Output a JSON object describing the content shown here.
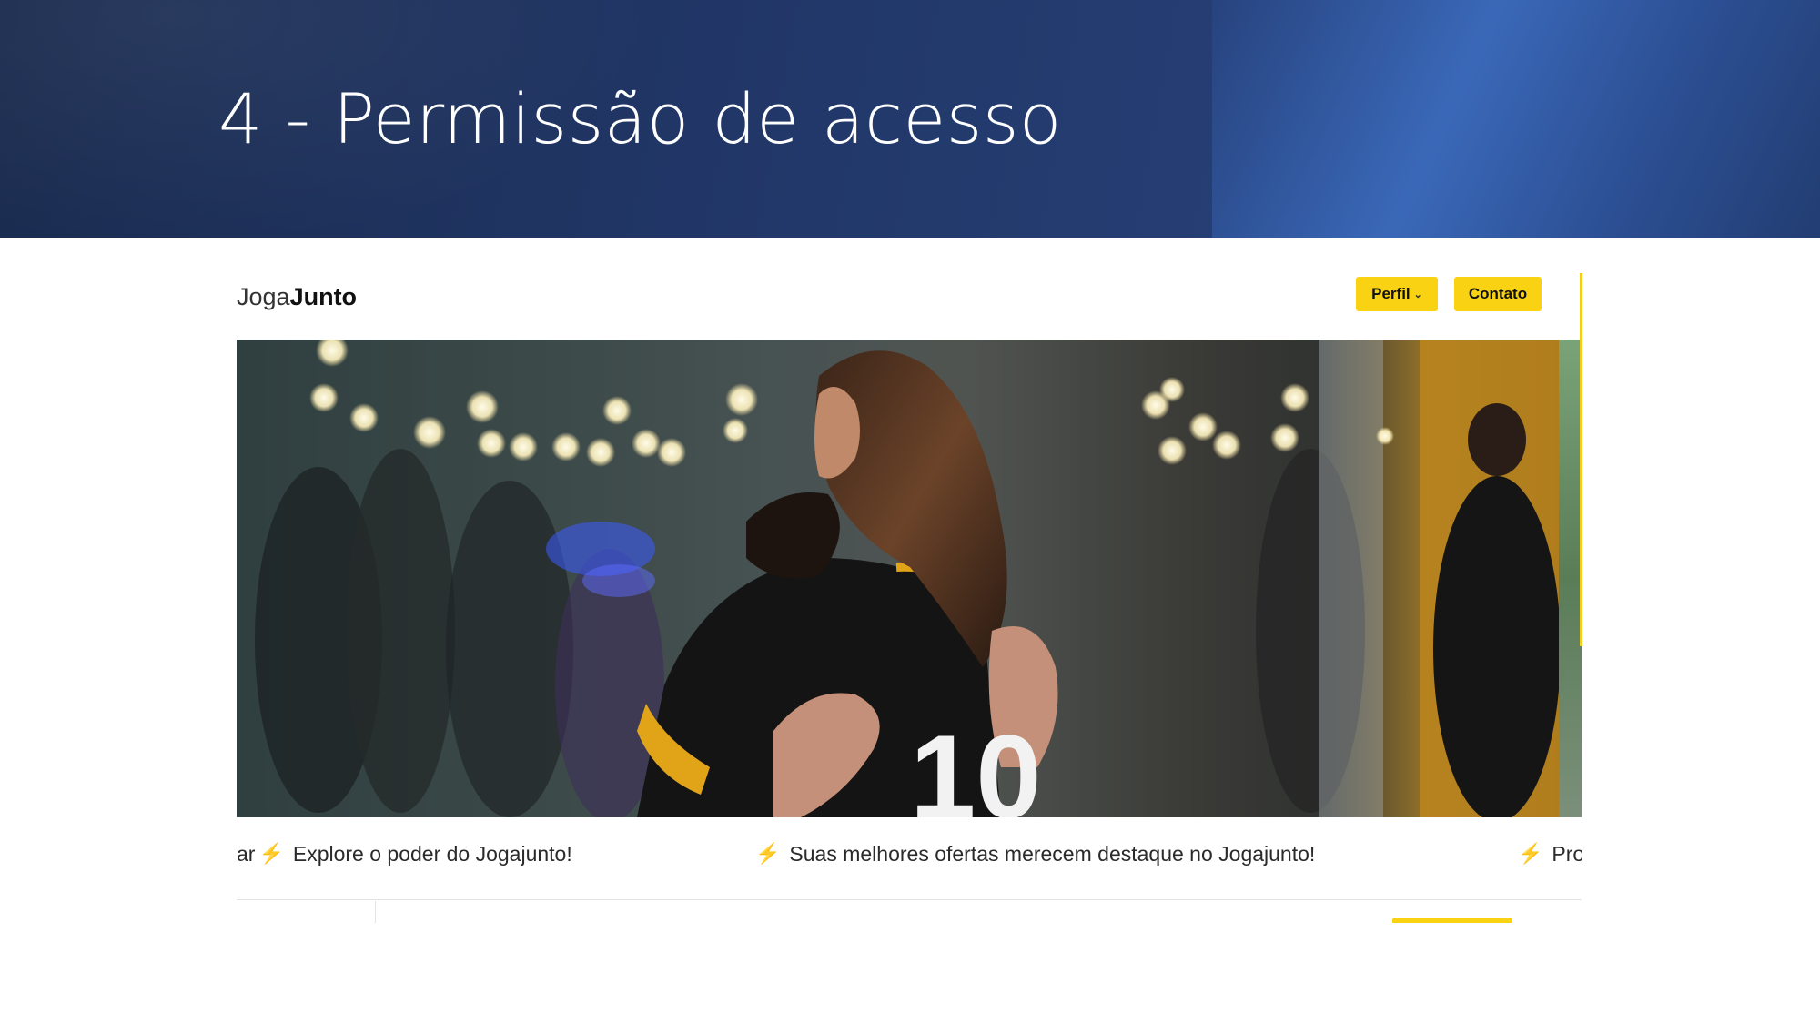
{
  "slide": {
    "title": "4 - Permissão de acesso"
  },
  "site": {
    "logo": {
      "light": "Joga",
      "bold": "Junto"
    },
    "nav": {
      "perfil_label": "Perfil",
      "contato_label": "Contato"
    },
    "hero": {
      "alt": "Jogajunto",
      "jersey_number": "10"
    },
    "marquee": [
      {
        "text": "ar",
        "icon": "lightning-icon"
      },
      {
        "text": "Explore o poder do Jogajunto!",
        "icon": "lightning-icon"
      },
      {
        "text": "Suas melhores ofertas merecem destaque no Jogajunto!",
        "icon": "lightning-icon"
      },
      {
        "text": "Pro"
      }
    ]
  },
  "colors": {
    "header_dark": "#1a2b4f",
    "header_light": "#3a68b8",
    "accent_yellow": "#f8d213",
    "bolt_yellow": "#f5c518"
  }
}
